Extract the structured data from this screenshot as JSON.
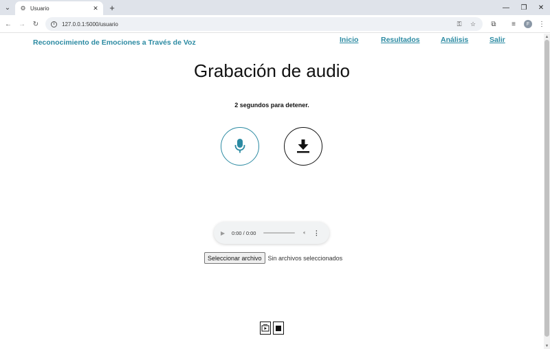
{
  "browser": {
    "tab_title": "Usuario",
    "url": "127.0.0.1:5000/usuario",
    "profile_initial": "F"
  },
  "header": {
    "brand": "Reconocimiento de Emociones a Través de Voz",
    "nav": [
      "Inicio",
      "Resultados",
      "Análisis",
      "Salir"
    ]
  },
  "main": {
    "title": "Grabación de audio",
    "countdown": "2 segundos para detener."
  },
  "audio_player": {
    "time": "0:00 / 0:00",
    "progress": 0
  },
  "file_input": {
    "button_label": "Seleccionar archivo",
    "status": "Sin archivos seleccionados"
  },
  "icons": {
    "record": "microphone-icon",
    "download": "download-icon",
    "play_small": "screen-play-icon",
    "stop_small": "stop-icon"
  },
  "colors": {
    "accent": "#2b8aa2",
    "dark": "#111111"
  }
}
